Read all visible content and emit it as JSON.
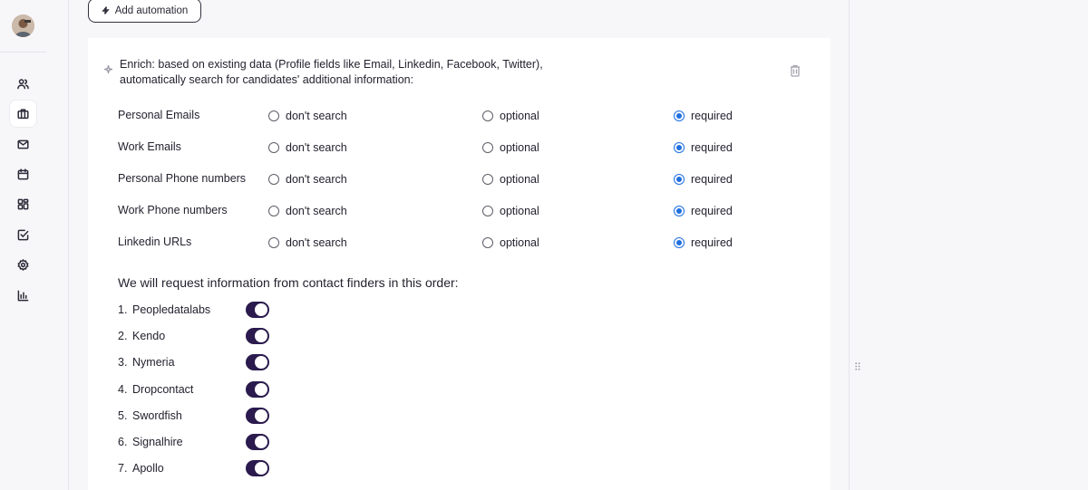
{
  "toolbar": {
    "add_automation_label": "Add automation"
  },
  "automation": {
    "intro_line1": "Enrich: based on existing data (Profile fields like Email, Linkedin, Facebook, Twitter),",
    "intro_line2": "automatically search for candidates' additional information:",
    "option_labels": [
      "don't search",
      "optional",
      "required"
    ],
    "fields": [
      {
        "label": "Personal Emails",
        "selected": "required"
      },
      {
        "label": "Work Emails",
        "selected": "required"
      },
      {
        "label": "Personal Phone numbers",
        "selected": "required"
      },
      {
        "label": "Work Phone numbers",
        "selected": "required"
      },
      {
        "label": "Linkedin URLs",
        "selected": "required"
      }
    ],
    "order_title": "We will request information from contact finders in this order:",
    "finders": [
      {
        "num": "1.",
        "name": "Peopledatalabs",
        "enabled": true
      },
      {
        "num": "2.",
        "name": "Kendo",
        "enabled": true
      },
      {
        "num": "3.",
        "name": "Nymeria",
        "enabled": true
      },
      {
        "num": "4.",
        "name": "Dropcontact",
        "enabled": true
      },
      {
        "num": "5.",
        "name": "Swordfish",
        "enabled": true
      },
      {
        "num": "6.",
        "name": "Signalhire",
        "enabled": true
      },
      {
        "num": "7.",
        "name": "Apollo",
        "enabled": true
      }
    ]
  },
  "sidebar": {
    "items": [
      {
        "icon": "users-icon"
      },
      {
        "icon": "briefcase-icon",
        "active": true
      },
      {
        "icon": "mail-icon"
      },
      {
        "icon": "calendar-icon"
      },
      {
        "icon": "dashboard-icon"
      },
      {
        "icon": "checkbox-icon"
      },
      {
        "icon": "gear-icon"
      },
      {
        "icon": "bar-chart-icon"
      }
    ]
  },
  "colors": {
    "accent_radio": "#1f6fe0",
    "toggle_on": "#2a1a4d"
  }
}
